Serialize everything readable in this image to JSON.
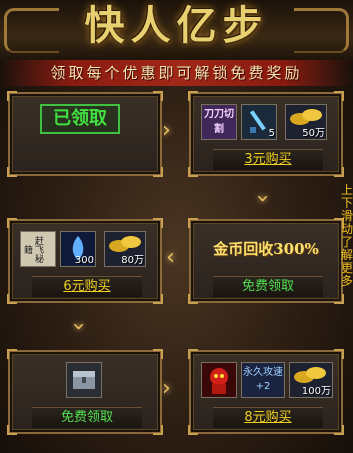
{
  "header": {
    "title": "快人亿步",
    "subtitle": "领取每个优惠即可解锁免费奖励"
  },
  "steps": [
    {
      "button": "已领取",
      "claimed": true,
      "items": []
    },
    {
      "button": "3元购买",
      "items": [
        {
          "label": "刀刀切割",
          "count": ""
        },
        {
          "icon": "jade-sword-icon",
          "count": "5"
        },
        {
          "icon": "gold-ingot-icon",
          "count": "50万"
        }
      ]
    },
    {
      "button": "6元购买",
      "items": [
        {
          "label": "赶飞秘籍",
          "count": ""
        },
        {
          "icon": "blue-flame-icon",
          "count": "300"
        },
        {
          "icon": "gold-ingot-icon",
          "count": "80万"
        }
      ]
    },
    {
      "button": "免费领取",
      "banner": "金币回收300%"
    },
    {
      "button": "免费领取",
      "items": [
        {
          "icon": "silver-chest-icon",
          "count": ""
        }
      ]
    },
    {
      "button": "8元购买",
      "items": [
        {
          "icon": "red-demon-icon",
          "count": ""
        },
        {
          "label": "永久攻速+2",
          "count": ""
        },
        {
          "icon": "gold-ingot-icon",
          "count": "100万"
        }
      ]
    }
  ],
  "side_hint": "上下滑动了解更多",
  "colors": {
    "gold": "#f0d020",
    "green": "#50e050",
    "border": "#8a6a3a"
  }
}
